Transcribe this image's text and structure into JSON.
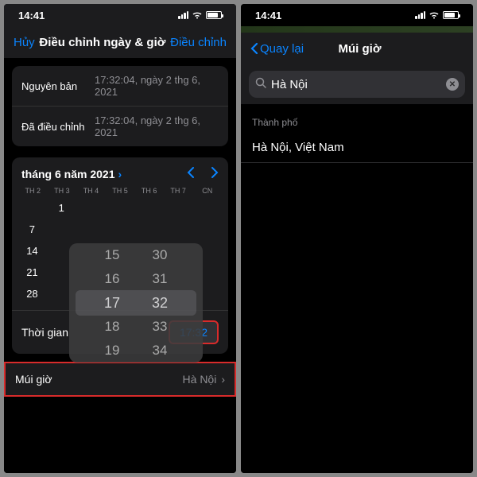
{
  "status": {
    "time": "14:41"
  },
  "left": {
    "nav": {
      "cancel": "Hủy",
      "title": "Điều chỉnh ngày & giờ",
      "adjust": "Điều chỉnh"
    },
    "info": {
      "original_label": "Nguyên bản",
      "original_val": "17:32:04, ngày 2 thg 6, 2021",
      "adjusted_label": "Đã điều chỉnh",
      "adjusted_val": "17:32:04, ngày 2 thg 6, 2021"
    },
    "calendar": {
      "month": "tháng 6 năm 2021",
      "weekdays": [
        "TH 2",
        "TH 3",
        "TH 4",
        "TH 5",
        "TH 6",
        "TH 7",
        "CN"
      ],
      "days": [
        "",
        "1",
        "",
        "",
        "",
        "",
        "",
        "7",
        "",
        "",
        "",
        "",
        "",
        "",
        "14",
        "",
        "",
        "",
        "",
        "",
        "",
        "21",
        "",
        "",
        "",
        "",
        "",
        "",
        "28",
        "",
        "",
        "",
        "",
        "",
        ""
      ]
    },
    "picker": {
      "hours": [
        "15",
        "16",
        "17",
        "18",
        "19"
      ],
      "minutes": [
        "30",
        "31",
        "32",
        "33",
        "34"
      ]
    },
    "time": {
      "label": "Thời gian",
      "value": "17:32"
    },
    "tz": {
      "label": "Múi giờ",
      "value": "Hà Nội"
    }
  },
  "right": {
    "nav": {
      "back": "Quay lại",
      "title": "Múi giờ"
    },
    "search": {
      "value": "Hà Nội"
    },
    "section": "Thành phố",
    "result": "Hà Nội, Việt Nam"
  }
}
